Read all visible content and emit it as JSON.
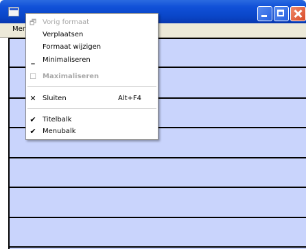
{
  "menubar": {
    "item": "Men"
  },
  "sysmenu": {
    "items": [
      {
        "label": "Vorig formaat",
        "disabled": true,
        "icon": "restore-icon"
      },
      {
        "label": "Verplaatsen",
        "disabled": false,
        "icon": ""
      },
      {
        "label": "Formaat wijzigen",
        "disabled": false,
        "icon": ""
      },
      {
        "label": "Minimaliseren",
        "disabled": false,
        "icon": "minimize-icon"
      },
      {
        "label": "Maximaliseren",
        "disabled": true,
        "icon": "maximize-icon"
      },
      {
        "label": "Sluiten",
        "accelerator": "Alt+F4",
        "disabled": false,
        "icon": "close-icon"
      },
      {
        "label": "Titelbalk",
        "checked": true,
        "icon": "check-icon"
      },
      {
        "label": "Menubalk",
        "checked": true,
        "icon": "check-icon"
      }
    ]
  }
}
